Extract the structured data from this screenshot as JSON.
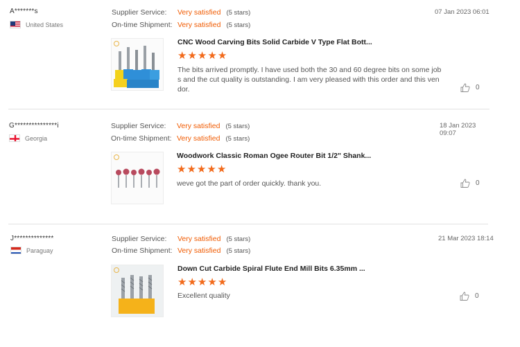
{
  "labels": {
    "supplier_service": "Supplier Service:",
    "ontime_shipment": "On-time Shipment:"
  },
  "reviews": [
    {
      "buyer": "A*******s",
      "country": "United States",
      "supplier_value": "Very satisfied",
      "supplier_stars": "(5 stars)",
      "shipment_value": "Very satisfied",
      "shipment_stars": "(5 stars)",
      "date": "07 Jan 2023 06:01",
      "product_title": "CNC Wood Carving Bits Solid Carbide V Type Flat Bott...",
      "rating": 5,
      "text_lines": [
        "The bits arrived promptly. I have used both the 30 and 60 degree bits on some job",
        "s and the cut quality is outstanding. I am very pleased with this order and this ven",
        "dor."
      ],
      "likes": "0"
    },
    {
      "buyer": "G***************i",
      "country": "Georgia",
      "supplier_value": "Very satisfied",
      "supplier_stars": "(5 stars)",
      "shipment_value": "Very satisfied",
      "shipment_stars": "(5 stars)",
      "date": "18 Jan 2023 09:07",
      "product_title": "Woodwork Classic Roman Ogee Router Bit 1/2\" Shank...",
      "rating": 5,
      "text_lines": [
        "weve got the part of order quickly. thank you."
      ],
      "likes": "0"
    },
    {
      "buyer": "J**************",
      "country": "Paraguay",
      "supplier_value": "Very satisfied",
      "supplier_stars": "(5 stars)",
      "shipment_value": "Very satisfied",
      "shipment_stars": "(5 stars)",
      "date": "21 Mar 2023 18:14",
      "product_title": "Down Cut Carbide Spiral Flute End Mill Bits 6.35mm ...",
      "rating": 5,
      "text_lines": [
        "Excellent quality"
      ],
      "likes": "0"
    }
  ],
  "colors": {
    "accent": "#f05a00",
    "star": "#f26a1b"
  }
}
